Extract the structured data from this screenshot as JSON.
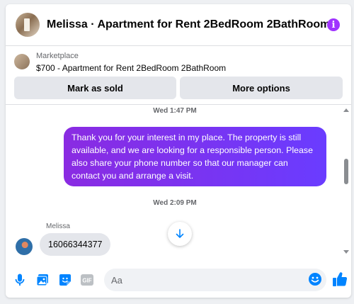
{
  "header": {
    "title": "Melissa · Apartment for Rent 2BedRoom 2BathRoom",
    "info_icon": "info-icon",
    "info_glyph": "i",
    "accent_color": "#a033ff"
  },
  "marketplace": {
    "label": "Marketplace",
    "listing": "$700 - Apartment for Rent 2BedRoom 2BathRoom",
    "mark_sold_label": "Mark as sold",
    "more_options_label": "More options"
  },
  "conversation": {
    "timestamp_1": "Wed 1:47 PM",
    "outgoing_message": "Thank you for your interest in my place. The property is still available, and we are looking for a responsible person. Please also share your phone number so that our manager can contact you and arrange a visit.",
    "timestamp_2": "Wed 2:09 PM",
    "sender_name": "Melissa",
    "incoming_message": "16066344377",
    "outgoing_bubble_colors": [
      "#8a2be2",
      "#6a3cff"
    ]
  },
  "composer": {
    "placeholder": "Aa",
    "value": "",
    "gif_label": "GIF",
    "icons": [
      "microphone-icon",
      "photo-icon",
      "sticker-icon",
      "gif-icon",
      "emoji-icon",
      "thumbs-up-icon"
    ],
    "icon_color": "#0084ff"
  }
}
